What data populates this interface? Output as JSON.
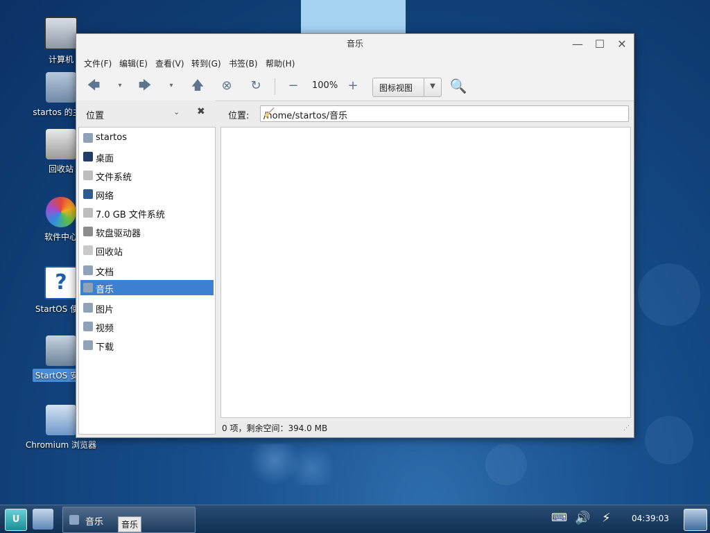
{
  "desktop": {
    "icons": [
      {
        "label": "计算机"
      },
      {
        "label": "startos 的主文"
      },
      {
        "label": "回收站"
      },
      {
        "label": "软件中心"
      },
      {
        "label": "StartOS 使用"
      },
      {
        "label": "StartOS 安装"
      },
      {
        "label": "Chromium 浏览器"
      }
    ]
  },
  "window": {
    "title": "音乐",
    "controls": {
      "minimize": "—",
      "maximize": "☐",
      "close": "✕"
    },
    "menu": [
      "文件(F)",
      "编辑(E)",
      "查看(V)",
      "转到(G)",
      "书签(B)",
      "帮助(H)"
    ],
    "toolbar": {
      "zoom": "100%",
      "view_mode": "图标视图"
    },
    "sidebar_header": {
      "label": "位置",
      "chevron": "⌄",
      "close": "✖"
    },
    "location": {
      "label": "位置:",
      "path": "/home/startos/音乐"
    },
    "sidebar": {
      "items": [
        {
          "label": "startos",
          "icon": "home-folder-icon"
        },
        {
          "label": "桌面",
          "icon": "desktop-icon"
        },
        {
          "label": "文件系统",
          "icon": "drive-icon"
        },
        {
          "label": "网络",
          "icon": "network-icon"
        },
        {
          "label": "7.0 GB 文件系统",
          "icon": "drive-icon"
        },
        {
          "label": "软盘驱动器",
          "icon": "floppy-icon"
        },
        {
          "label": "回收站",
          "icon": "trash-icon"
        },
        {
          "label": "文档",
          "icon": "documents-folder-icon"
        },
        {
          "label": "音乐",
          "icon": "music-folder-icon",
          "selected": true
        },
        {
          "label": "图片",
          "icon": "pictures-folder-icon"
        },
        {
          "label": "视频",
          "icon": "videos-folder-icon"
        },
        {
          "label": "下载",
          "icon": "downloads-folder-icon"
        }
      ]
    },
    "status": "0 项，剩余空间：394.0 MB"
  },
  "taskbar": {
    "task_label": "音乐",
    "tooltip": "音乐",
    "clock": "04:39:03"
  },
  "colors": {
    "selection": "#3d80d2",
    "taskbar": "#0f2f54",
    "desktop": "#184f8c"
  }
}
